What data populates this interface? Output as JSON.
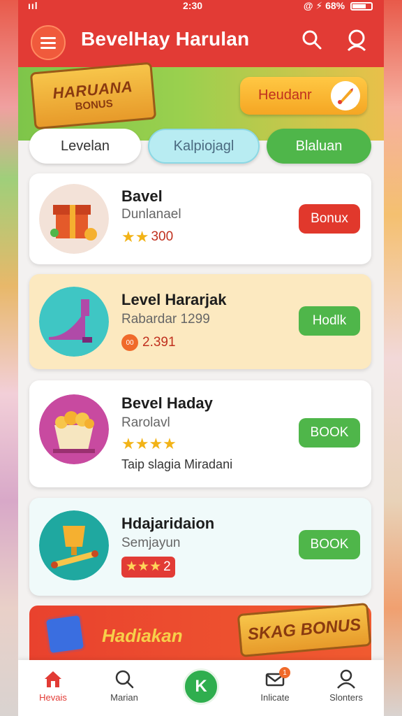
{
  "status_bar": {
    "signal": "ııl",
    "time": "2:30",
    "right": "@ ⚡ 68%"
  },
  "header": {
    "title": "BevelHay Harulan",
    "menu_icon": "menu-icon",
    "search_icon": "search-icon",
    "profile_icon": "user-icon"
  },
  "banner": {
    "sign_line1": "HARUANA",
    "sign_line2": "BONUS",
    "button_label": "Heudanr"
  },
  "tabs": [
    {
      "label": "Levelan"
    },
    {
      "label": "Kalpiojagl"
    },
    {
      "label": "Blaluan"
    }
  ],
  "cards": [
    {
      "title": "Bavel",
      "subtitle": "Dunlanael",
      "stars": "★★",
      "rating": "300",
      "button": "Bonux",
      "button_color": "#e1382c"
    },
    {
      "title": "Level Hararjak",
      "subtitle": "Rabardar 1299",
      "coin_label": "00",
      "coins": "2.391",
      "button": "Hodlk",
      "button_color": "#4fb64a"
    },
    {
      "title": "Bevel Haday",
      "subtitle": "Rarolavl",
      "stars": "★★★★",
      "extra": "Taip slagia Miradani",
      "button": "BOOK",
      "button_color": "#4fb64a"
    },
    {
      "title": "Hdajaridaion",
      "subtitle": "Semjayun",
      "stars": "★★★",
      "rating": "2",
      "button": "BOOK",
      "button_color": "#4fb64a"
    }
  ],
  "bottom_banner": {
    "label": "Hadiakan",
    "sign": "SKAG BONUS"
  },
  "nav": [
    {
      "label": "Hevais",
      "icon": "home-icon"
    },
    {
      "label": "Marian",
      "icon": "search-icon"
    },
    {
      "label": "K",
      "icon": "center-action"
    },
    {
      "label": "Inlicate",
      "icon": "mail-icon",
      "badge": "1"
    },
    {
      "label": "Slonters",
      "icon": "user-icon"
    }
  ],
  "colors": {
    "header": "#e23b35",
    "green": "#4fb64a",
    "accent": "#f5a623"
  }
}
